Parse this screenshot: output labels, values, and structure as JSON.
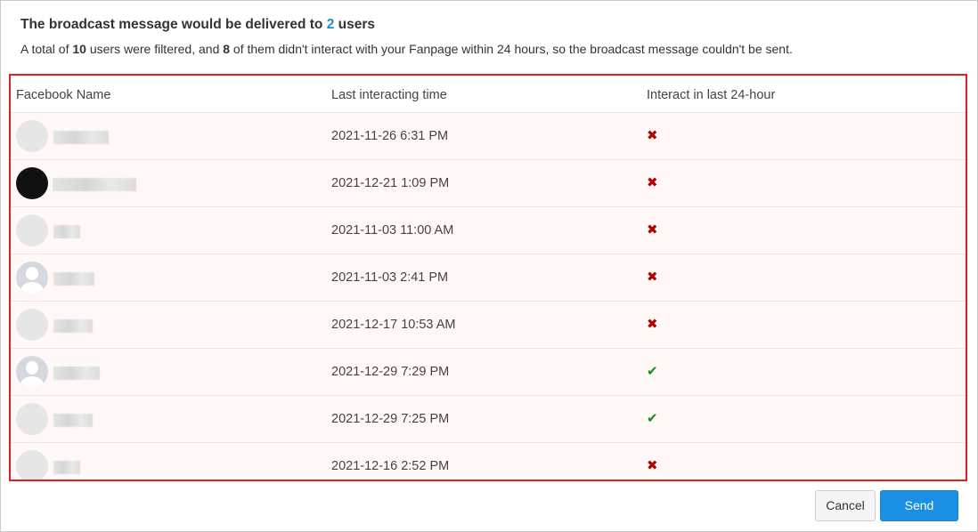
{
  "heading": {
    "prefix": "The broadcast message would be delivered to ",
    "count": "2",
    "suffix": " users"
  },
  "subtext": {
    "part1": "A total of ",
    "total": "10",
    "part2": " users were filtered, and ",
    "failed": "8",
    "part3": " of them didn't interact with your Fanpage within 24 hours, so the broadcast message couldn't be sent."
  },
  "table": {
    "columns": [
      "Facebook Name",
      "Last interacting time",
      "Interact in last 24-hour"
    ],
    "rows": [
      {
        "avatar": "blank-avatar",
        "time": "2021-11-26 6:31 PM",
        "interacted": false,
        "status_icon": "cross-icon"
      },
      {
        "avatar": "dark-avatar",
        "time": "2021-12-21 1:09 PM",
        "interacted": false,
        "status_icon": "cross-icon"
      },
      {
        "avatar": "blank-avatar",
        "time": "2021-11-03 11:00 AM",
        "interacted": false,
        "status_icon": "cross-icon"
      },
      {
        "avatar": "person-avatar",
        "time": "2021-11-03 2:41 PM",
        "interacted": false,
        "status_icon": "cross-icon"
      },
      {
        "avatar": "blank-avatar",
        "time": "2021-12-17 10:53 AM",
        "interacted": false,
        "status_icon": "cross-icon"
      },
      {
        "avatar": "person-avatar",
        "time": "2021-12-29 7:29 PM",
        "interacted": true,
        "status_icon": "check-icon"
      },
      {
        "avatar": "blank-avatar",
        "time": "2021-12-29 7:25 PM",
        "interacted": true,
        "status_icon": "check-icon"
      },
      {
        "avatar": "blank-avatar",
        "time": "2021-12-16 2:52 PM",
        "interacted": false,
        "status_icon": "cross-icon"
      }
    ]
  },
  "glyphs": {
    "cross": "✖",
    "check": "✔"
  },
  "colors": {
    "highlight_border": "#e02020",
    "accent": "#1a8fd6",
    "cross": "#b00000",
    "check": "#1a8a1a"
  },
  "buttons": {
    "cancel": "Cancel",
    "send": "Send"
  }
}
